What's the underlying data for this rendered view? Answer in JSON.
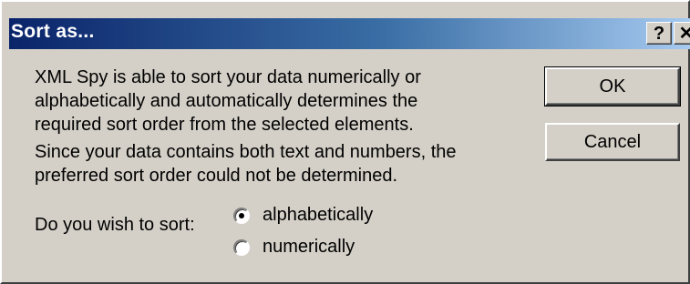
{
  "window": {
    "title": "Sort as...",
    "help_glyph": "?",
    "close_glyph": "✕"
  },
  "message": {
    "line1": "XML Spy is able to sort your data numerically or",
    "line2": "alphabetically and automatically determines the",
    "line3": "required sort order from the selected elements.",
    "line4": "Since your data contains both text and numbers, the",
    "line5": "preferred sort order could not be determined."
  },
  "sort_option": {
    "prompt": "Do you wish to sort:",
    "options": [
      {
        "label": "alphabetically",
        "selected": true
      },
      {
        "label": "numerically",
        "selected": false
      }
    ]
  },
  "buttons": {
    "ok": "OK",
    "cancel": "Cancel"
  }
}
